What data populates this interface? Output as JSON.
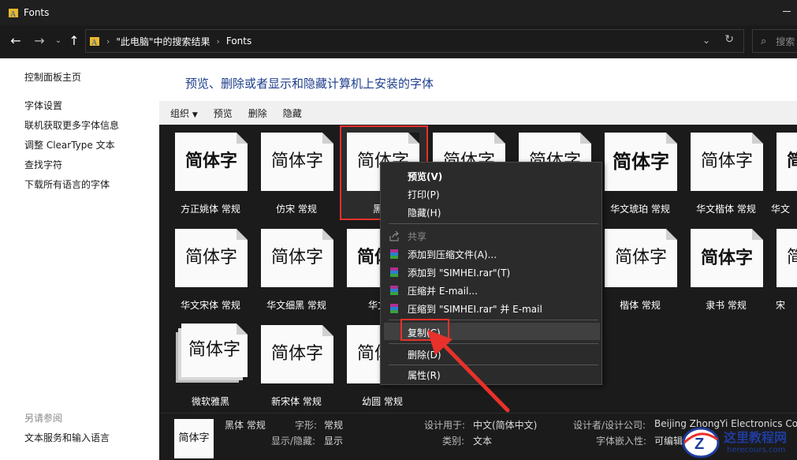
{
  "window": {
    "title": "Fonts"
  },
  "address": {
    "crumbs": [
      "\"此电脑\"中的搜索结果",
      "Fonts"
    ],
    "search_placeholder": "搜索"
  },
  "sidebar": {
    "links": [
      "控制面板主页",
      "字体设置",
      "联机获取更多字体信息",
      "调整 ClearType 文本",
      "查找字符",
      "下载所有语言的字体"
    ],
    "see_also_title": "另请参阅",
    "see_also_links": [
      "文本服务和输入语言"
    ]
  },
  "main": {
    "heading": "预览、删除或者显示和隐藏计算机上安装的字体"
  },
  "toolbar": {
    "organize": "组织",
    "preview": "预览",
    "delete": "删除",
    "hide": "隐藏"
  },
  "preview_text": "简体字",
  "fonts": [
    {
      "label": "方正姚体 常规"
    },
    {
      "label": "仿宋 常规"
    },
    {
      "label": "黑体"
    },
    {
      "label": ""
    },
    {
      "label": ""
    },
    {
      "label": "华文琥珀 常规"
    },
    {
      "label": "华文楷体 常规"
    },
    {
      "label": "华文"
    },
    {
      "label": "华文宋体 常规"
    },
    {
      "label": "华文细黑 常规"
    },
    {
      "label": "华文新"
    },
    {
      "label": ""
    },
    {
      "label": ""
    },
    {
      "label": "楷体 常规"
    },
    {
      "label": "隶书 常规"
    },
    {
      "label": "宋"
    },
    {
      "label": "微软雅黑"
    },
    {
      "label": "新宋体 常规"
    },
    {
      "label": "幼圆 常规"
    }
  ],
  "context_menu": {
    "items": [
      "预览(V)",
      "打印(P)",
      "隐藏(H)",
      "共享",
      "添加到压缩文件(A)...",
      "添加到 \"SIMHEI.rar\"(T)",
      "压缩并 E-mail...",
      "压缩到 \"SIMHEI.rar\" 并 E-mail",
      "复制(C)",
      "删除(D)",
      "属性(R)"
    ]
  },
  "details": {
    "name": "黑体 常规",
    "style_key": "字形:",
    "style_val": "常规",
    "visibility_key": "显示/隐藏:",
    "visibility_val": "显示",
    "designed_for_key": "设计用于:",
    "designed_for_val": "中文(简体中文)",
    "category_key": "类别:",
    "category_val": "文本",
    "designer_key": "设计者/设计公司:",
    "designer_val": "Beijing ZhongYi Electronics Co",
    "embed_key": "字体嵌入性:",
    "embed_val": "可编辑"
  },
  "watermark": {
    "name": "这里教程网",
    "url": "herecours.com"
  },
  "colors": {
    "accent_red": "#e8312a",
    "heading_blue": "#1e3f8c"
  }
}
